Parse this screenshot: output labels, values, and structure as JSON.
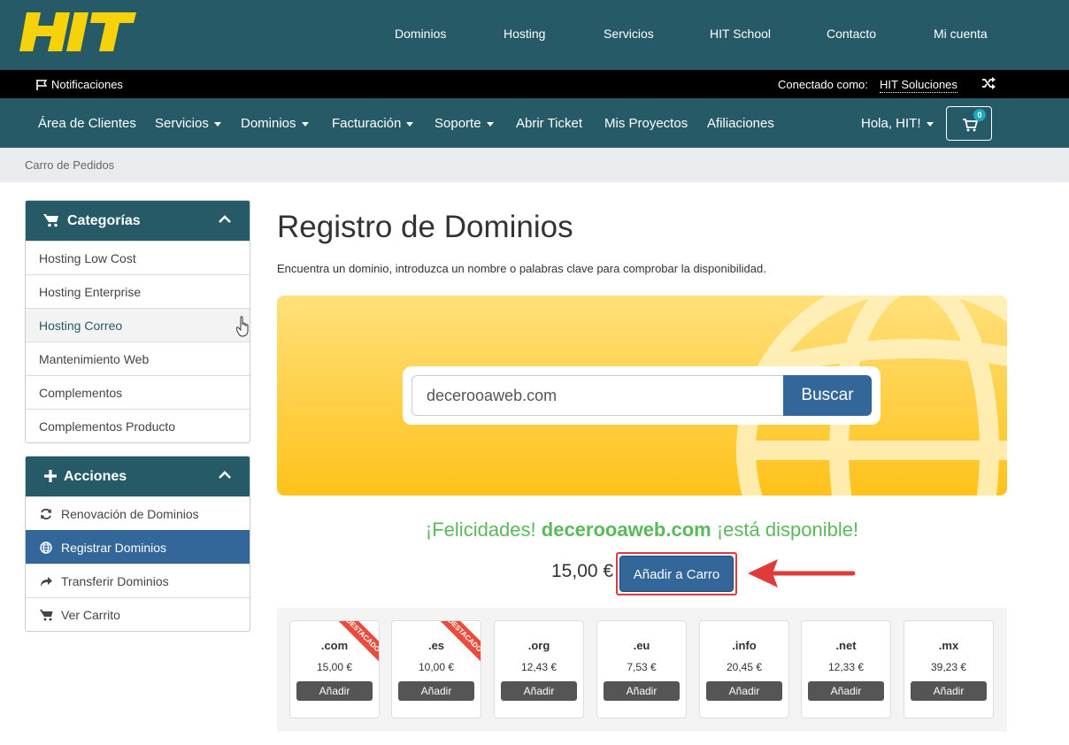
{
  "brand": {
    "logo_text": "HIT"
  },
  "topnav": [
    "Dominios",
    "Hosting",
    "Servicios",
    "HIT School",
    "Contacto",
    "Mi cuenta"
  ],
  "notifbar": {
    "notifications": "Notificaciones",
    "connected_as": "Conectado como:",
    "user": "HIT Soluciones"
  },
  "mainnav": {
    "items": [
      {
        "label": "Área de Clientes"
      },
      {
        "label": "Servicios"
      },
      {
        "label": "Dominios"
      },
      {
        "label": "Facturación"
      },
      {
        "label": "Soporte"
      },
      {
        "label": "Abrir Ticket"
      },
      {
        "label": "Mis Proyectos"
      },
      {
        "label": "Afiliaciones"
      }
    ],
    "greeting": "Hola, HIT!",
    "cart_count": "0"
  },
  "breadcrumb": "Carro de Pedidos",
  "sidebar": {
    "categories": {
      "title": "Categorías",
      "items": [
        "Hosting Low Cost",
        "Hosting Enterprise",
        "Hosting Correo",
        "Mantenimiento Web",
        "Complementos",
        "Complementos Producto"
      ]
    },
    "actions": {
      "title": "Acciones",
      "items": [
        "Renovación de Dominios",
        "Registrar Dominios",
        "Transferir Dominios",
        "Ver Carrito"
      ]
    }
  },
  "main": {
    "title": "Registro de Dominios",
    "description": "Encuentra un dominio, introduzca un nombre o palabras clave para comprobar la disponibilidad.",
    "search_value": "decerooaweb.com",
    "search_button": "Buscar",
    "result_prefix": "¡Felicidades!",
    "result_domain": "decerooaweb.com",
    "result_suffix": "¡está disponible!",
    "price": "15,00 €",
    "add_to_cart": "Añadir a Carro"
  },
  "tlds": [
    {
      "name": ".com",
      "price": "15,00 €",
      "button": "Añadir",
      "ribbon": "DESTACADO"
    },
    {
      "name": ".es",
      "price": "10,00 €",
      "button": "Añadir",
      "ribbon": "DESTACADO"
    },
    {
      "name": ".org",
      "price": "12,43 €",
      "button": "Añadir",
      "ribbon": ""
    },
    {
      "name": ".eu",
      "price": "7,53 €",
      "button": "Añadir",
      "ribbon": ""
    },
    {
      "name": ".info",
      "price": "20,45 €",
      "button": "Añadir",
      "ribbon": ""
    },
    {
      "name": ".net",
      "price": "12,33 €",
      "button": "Añadir",
      "ribbon": ""
    },
    {
      "name": ".mx",
      "price": "39,23 €",
      "button": "Añadir",
      "ribbon": ""
    }
  ],
  "colors": {
    "teal": "#255a66",
    "blue": "#336699",
    "green": "#5cb85c",
    "yellow": "#ffc21a",
    "red": "#e03a3a"
  }
}
